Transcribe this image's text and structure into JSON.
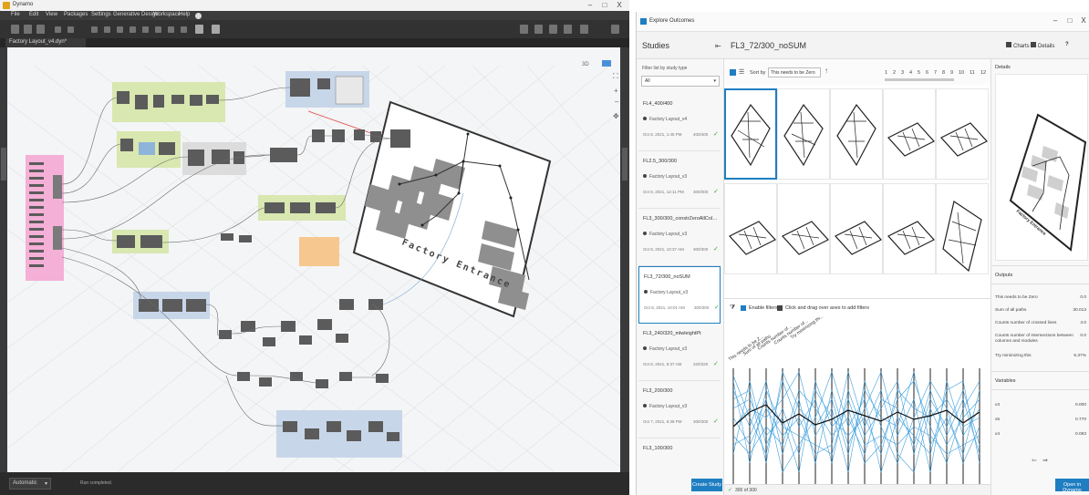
{
  "dynamo": {
    "title": "Dynamo",
    "menu": [
      "File",
      "Edit",
      "View",
      "Packages",
      "Settings",
      "Generative Design",
      "Workspace",
      "Help"
    ],
    "tab": "Factory Layout_v4.dyn*",
    "zoom_label": "3D",
    "run_mode": "Automatic",
    "run_status": "Run completed.",
    "canvas_text": "Factory Entrance",
    "window_controls": [
      "–",
      "□",
      "X"
    ]
  },
  "explore": {
    "window_title": "Explore Outcomes",
    "window_controls": [
      "–",
      "□",
      "X"
    ],
    "studies_heading": "Studies",
    "study_title": "FL3_72/300_noSUM",
    "header_controls": {
      "charts": "Charts",
      "details": "Details",
      "help": "?"
    },
    "filter_label": "Filter list by study type",
    "filter_value": "All",
    "studies": [
      {
        "name": "FL4_400/400",
        "file": "Factory Layout_v4",
        "date": "Oct 8, 2021, 1:45 PM",
        "count": "400/400"
      },
      {
        "name": "FL2.5_300/300",
        "file": "Factory Layout_v3",
        "date": "Oct 8, 2021, 12:11 PM",
        "count": "300/300"
      },
      {
        "name": "FL3_300/300_constrZeroAllColumns",
        "file": "Factory Layout_v3",
        "date": "Oct 8, 2021, 10:37 AM",
        "count": "300/300"
      },
      {
        "name": "FL3_72/300_noSUM",
        "file": "Factory Layout_v3",
        "date": "Oct 8, 2021, 10:01 AM",
        "count": "300/300"
      },
      {
        "name": "FL3_240/320_mlwleightPt",
        "file": "Factory Layout_v3",
        "date": "Oct 8, 2021, 9:37 AM",
        "count": "320/320"
      },
      {
        "name": "FL3_200/300",
        "file": "Factory Layout_v3",
        "date": "Oct 7, 2021, 6:38 PM",
        "count": "300/300"
      },
      {
        "name": "FL3_100/300",
        "file": "",
        "date": "",
        "count": ""
      }
    ],
    "create_study": "Create Study",
    "sort_label": "Sort by",
    "sort_value": "This needs to be Zero",
    "pages": [
      "1",
      "2",
      "3",
      "4",
      "5",
      "6",
      "7",
      "8",
      "9",
      "10",
      "11",
      "12"
    ],
    "filters_label": "Enable filters",
    "filters_hint": "Click and drag over axes to add filters",
    "axis_labels": [
      "This needs to be Z...",
      "Sum of all paths",
      "Counts number of...",
      "Counts number of...",
      "Try minimizing thi..."
    ],
    "status_text": "300 of 300",
    "details": {
      "heading": "Details",
      "outputs_heading": "Outputs",
      "outputs": [
        {
          "label": "This needs to be Zero",
          "value": "0.0"
        },
        {
          "label": "Sum of all paths",
          "value": "30.013"
        },
        {
          "label": "Counts number of crossed lines",
          "value": "4.0"
        },
        {
          "label": "Counts number of intersections between columns and modules",
          "value": "0.0"
        },
        {
          "label": "Try minimizing this",
          "value": "5.37%"
        }
      ],
      "variables_heading": "Variables",
      "variables": [
        {
          "label": "x3",
          "value": "0.000"
        },
        {
          "label": "x5",
          "value": "0.770"
        },
        {
          "label": "x4",
          "value": "0.083"
        }
      ],
      "open_button": "Open in Dynamo"
    }
  },
  "colors": {
    "accent": "#1f7ec1",
    "dynamo_dark": "#2b2b2b",
    "check_green": "#3aa83a",
    "group_green": "#d6e6a8",
    "group_blue": "#c3d3e8",
    "group_pink": "#f4a8d4",
    "group_orange": "#f7c48a",
    "parallel_line": "#1f8fd6"
  }
}
